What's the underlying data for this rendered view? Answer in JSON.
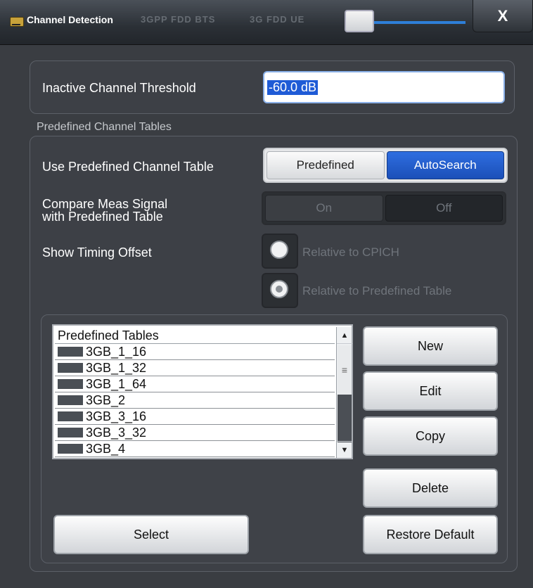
{
  "window": {
    "title": "Channel Detection",
    "background_tabs": [
      "3GPP FDD BTS",
      "3G FDD UE"
    ],
    "close_label": "X"
  },
  "threshold": {
    "label": "Inactive Channel Threshold",
    "value": "-60.0 dB"
  },
  "section": {
    "title": "Predefined Channel Tables"
  },
  "use_table": {
    "label": "Use Predefined Channel Table",
    "options": [
      "Predefined",
      "AutoSearch"
    ],
    "selected": "AutoSearch"
  },
  "compare": {
    "label_line1": "Compare Meas Signal",
    "label_line2": "with Predefined Table",
    "options": [
      "On",
      "Off"
    ],
    "selected": "Off",
    "enabled": false
  },
  "timing": {
    "label": "Show Timing Offset",
    "options": [
      "Relative to CPICH",
      "Relative to Predefined Table"
    ],
    "selected": "Relative to Predefined Table",
    "enabled": false
  },
  "tables": {
    "header": "Predefined Tables",
    "rows": [
      "3GB_1_16",
      "3GB_1_32",
      "3GB_1_64",
      "3GB_2",
      "3GB_3_16",
      "3GB_3_32",
      "3GB_4"
    ]
  },
  "buttons": {
    "new": "New",
    "edit": "Edit",
    "copy": "Copy",
    "delete": "Delete",
    "restore": "Restore Default",
    "select": "Select"
  },
  "colors": {
    "accent": "#1f5bd6",
    "background": "#3a3d42"
  }
}
